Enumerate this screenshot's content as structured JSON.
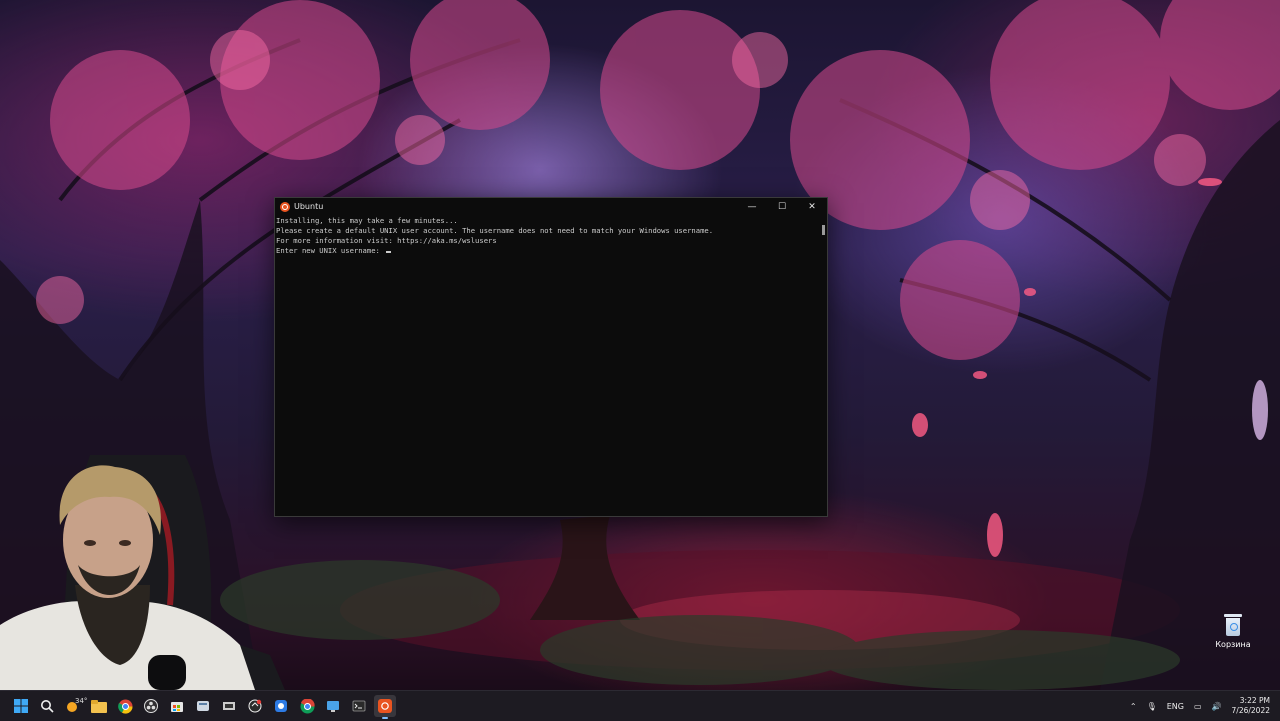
{
  "terminal": {
    "title": "Ubuntu",
    "lines": [
      "Installing, this may take a few minutes...",
      "Please create a default UNIX user account. The username does not need to match your Windows username.",
      "For more information visit: https://aka.ms/wslusers",
      "Enter new UNIX username: "
    ],
    "controls": {
      "minimize": "—",
      "maximize": "☐",
      "close": "✕"
    }
  },
  "desktop": {
    "recycle_bin_label": "Корзина"
  },
  "taskbar": {
    "weather_temp": "34°",
    "pinned": [
      "windows-start",
      "search",
      "weather",
      "file-explorer",
      "chrome",
      "obs",
      "store",
      "widget",
      "app-a",
      "app-b",
      "app-c",
      "chrome-alt",
      "remote-desktop",
      "terminal",
      "ubuntu"
    ]
  },
  "tray": {
    "language": "ENG",
    "time": "3:22 PM",
    "date": "7/26/2022"
  },
  "colors": {
    "terminal_bg": "#0c0c0c",
    "terminal_text": "#cccccc",
    "ubuntu_orange": "#e95420",
    "taskbar_bg": "#1d1b22"
  }
}
